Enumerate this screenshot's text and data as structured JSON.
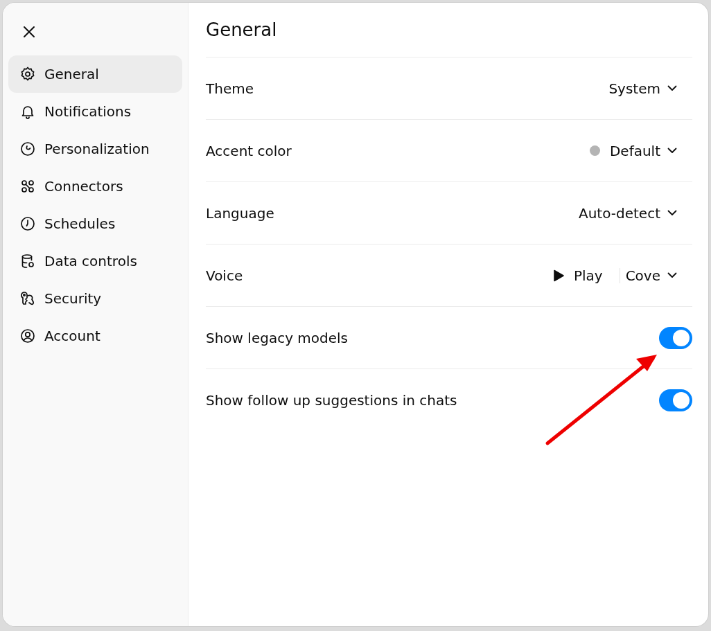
{
  "sidebar": {
    "items": [
      {
        "label": "General",
        "selected": true
      },
      {
        "label": "Notifications",
        "selected": false
      },
      {
        "label": "Personalization",
        "selected": false
      },
      {
        "label": "Connectors",
        "selected": false
      },
      {
        "label": "Schedules",
        "selected": false
      },
      {
        "label": "Data controls",
        "selected": false
      },
      {
        "label": "Security",
        "selected": false
      },
      {
        "label": "Account",
        "selected": false
      }
    ]
  },
  "content": {
    "title": "General",
    "settings": [
      {
        "kind": "select",
        "label": "Theme",
        "value": "System"
      },
      {
        "kind": "select",
        "label": "Accent color",
        "value": "Default",
        "color": "#b4b4b4"
      },
      {
        "kind": "select",
        "label": "Language",
        "value": "Auto-detect"
      },
      {
        "kind": "voice",
        "label": "Voice",
        "play_label": "Play",
        "value": "Cove"
      },
      {
        "kind": "toggle",
        "label": "Show legacy models",
        "on": true
      },
      {
        "kind": "toggle",
        "label": "Show follow up suggestions in chats",
        "on": true
      }
    ]
  }
}
